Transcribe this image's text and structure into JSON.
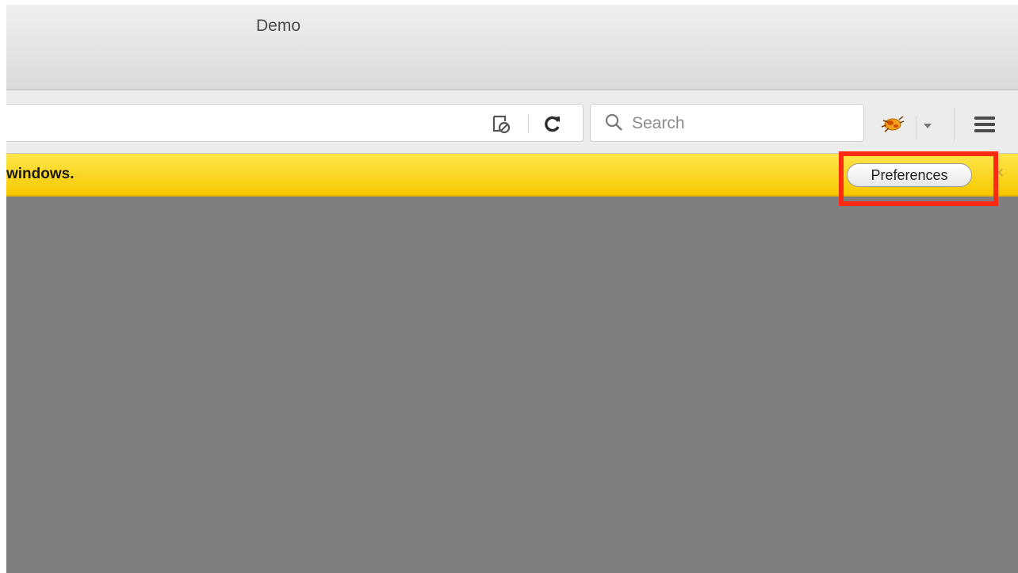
{
  "window": {
    "title": "Demo"
  },
  "toolbar": {
    "search_placeholder": "Search",
    "icons": [
      "page-blocked-icon",
      "reload-icon",
      "search-icon",
      "firebug-icon",
      "dropdown-arrow-icon",
      "hamburger-menu-icon"
    ]
  },
  "notification": {
    "message": "windows.",
    "button_label": "Preferences",
    "close_label": "×"
  },
  "colors": {
    "notification_bg": "#f9d100",
    "highlight": "#ff2a12",
    "content_bg": "#7f7f7f"
  }
}
